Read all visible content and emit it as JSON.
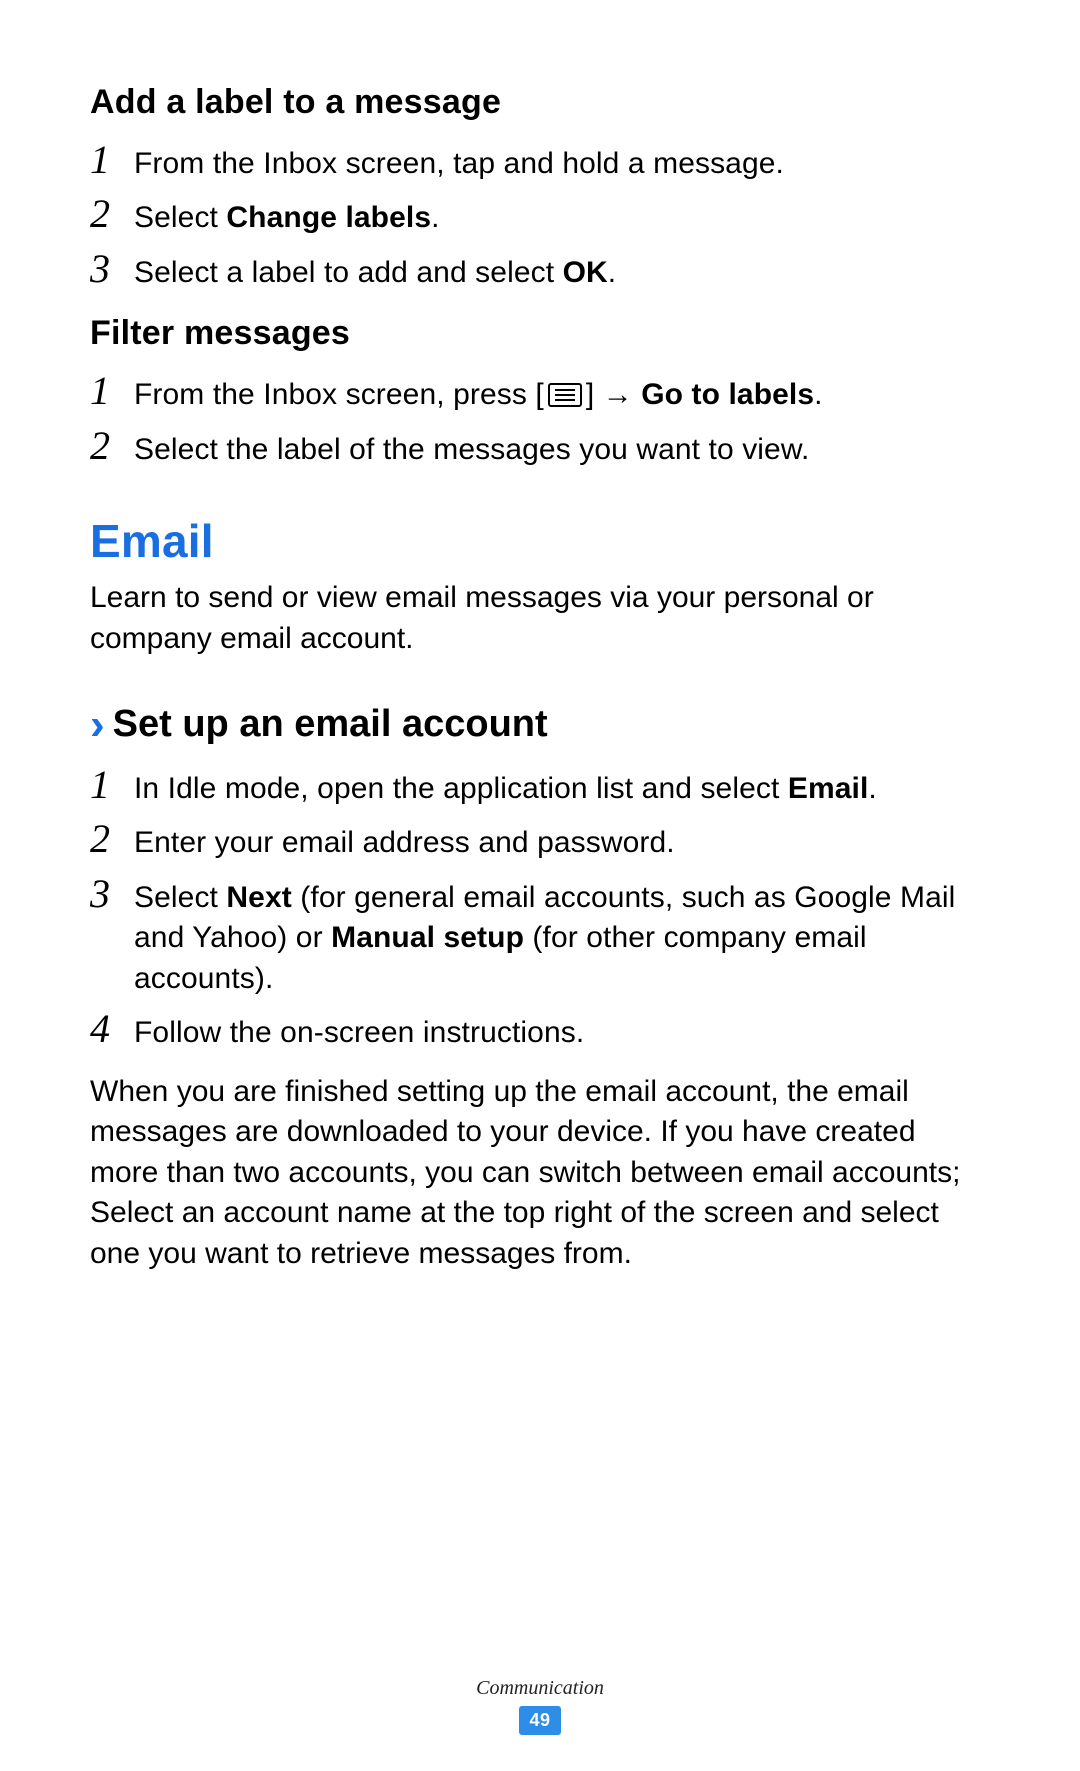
{
  "addLabel": {
    "heading": "Add a label to a message",
    "steps": [
      {
        "num": "1",
        "pre": "From the Inbox screen, tap and hold a message.",
        "bold": "",
        "post": ""
      },
      {
        "num": "2",
        "pre": "Select ",
        "bold": "Change labels",
        "post": "."
      },
      {
        "num": "3",
        "pre": "Select a label to add and select ",
        "bold": "OK",
        "post": "."
      }
    ]
  },
  "filter": {
    "heading": "Filter messages",
    "step1": {
      "num": "1",
      "pre": "From the Inbox screen, press [",
      "post": "] → ",
      "bold": "Go to labels",
      "tail": "."
    },
    "step2": {
      "num": "2",
      "text": "Select the label of the messages you want to view."
    }
  },
  "email": {
    "title": "Email",
    "intro": "Learn to send or view email messages via your personal or company email account."
  },
  "setup": {
    "heading": "Set up an email account",
    "step1": {
      "num": "1",
      "pre": "In Idle mode, open the application list and select ",
      "bold": "Email",
      "post": "."
    },
    "step2": {
      "num": "2",
      "text": "Enter your email address and password."
    },
    "step3": {
      "num": "3",
      "pre": "Select ",
      "bold1": "Next",
      "mid": " (for general email accounts, such as Google Mail and Yahoo) or ",
      "bold2": "Manual setup",
      "post": " (for other company email accounts)."
    },
    "step4": {
      "num": "4",
      "text": "Follow the on-screen instructions."
    },
    "closing": "When you are finished setting up the email account, the email messages are downloaded to your device. If you have created more than two accounts, you can switch between email accounts; Select an account name at the top right of the screen and select one you want to retrieve messages from."
  },
  "footer": {
    "section": "Communication",
    "page": "49"
  }
}
